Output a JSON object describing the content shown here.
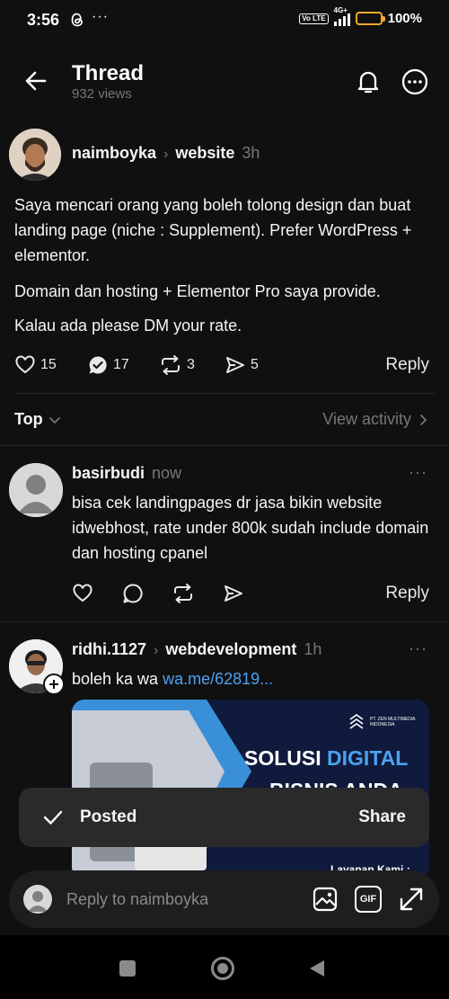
{
  "status_bar": {
    "time": "3:56",
    "more": "···",
    "network_badge": "Vo LTE",
    "network_type": "4G+",
    "battery": "100%"
  },
  "header": {
    "title": "Thread",
    "views": "932 views"
  },
  "post": {
    "author": "naimboyka",
    "community": "website",
    "time": "3h",
    "paragraphs": [
      "Saya mencari orang yang boleh tolong design dan buat landing page (niche : Supplement). Prefer WordPress + elementor.",
      "Domain dan hosting + Elementor Pro saya provide.",
      "Kalau ada please DM your rate."
    ],
    "likes": "15",
    "replies": "17",
    "reposts": "3",
    "shares": "5",
    "reply_label": "Reply"
  },
  "sort": {
    "label": "Top",
    "view_activity": "View activity"
  },
  "reply1": {
    "author": "basirbudi",
    "time": "now",
    "text": "bisa cek landingpages dr jasa bikin website idwebhost, rate under 800k sudah include domain dan hosting cpanel",
    "reply_label": "Reply"
  },
  "reply2": {
    "author": "ridhi.1127",
    "community": "webdevelopment",
    "time": "1h",
    "text": "boleh ka wa",
    "link": "wa.me/62819...",
    "card": {
      "company": "PT. ZEN MULTIMEDIA INDONESIA",
      "headline_1": "SOLUSI",
      "headline_2": "DIGITAL",
      "headline_3": "BISNIS ANDA",
      "services_label": "Layanan Kami :"
    }
  },
  "toast": {
    "label": "Posted",
    "action": "Share"
  },
  "composer": {
    "placeholder": "Reply to naimboyka",
    "gif_label": "GIF"
  },
  "colors": {
    "background": "#101010",
    "link": "#4ea1f5",
    "muted": "#777777",
    "accent_blue": "#4aa3f0"
  },
  "icons": [
    "back-arrow-icon",
    "bell-icon",
    "more-icon",
    "heart-icon",
    "comment-icon",
    "repost-icon",
    "send-icon",
    "chevron-down-icon",
    "chevron-right-icon",
    "image-icon",
    "gif-icon",
    "expand-icon",
    "check-icon",
    "plus-icon"
  ]
}
